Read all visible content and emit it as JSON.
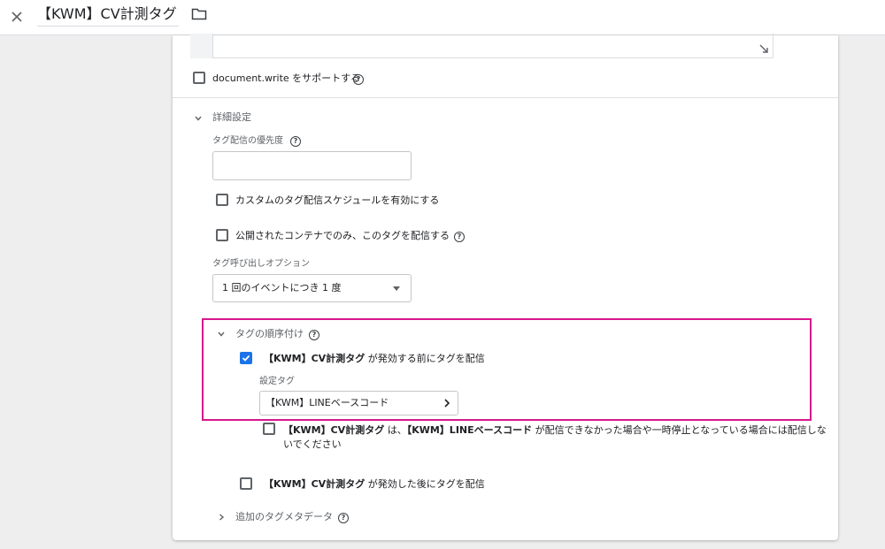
{
  "header": {
    "title": "【KWM】CV計測タグ",
    "close_icon": "close-icon",
    "folder_icon": "folder-icon"
  },
  "settings": {
    "document_write": {
      "label": "document.write をサポートする",
      "checked": false
    },
    "advanced": {
      "label": "詳細設定",
      "priority": {
        "label": "タグ配信の優先度",
        "value": ""
      },
      "custom_schedule": {
        "label": "カスタムのタグ配信スケジュールを有効にする",
        "checked": false
      },
      "published_only": {
        "label": "公開されたコンテナでのみ、このタグを配信する",
        "checked": false
      },
      "firing_option": {
        "label": "タグ呼び出しオプション",
        "value": "1 回のイベントにつき 1 度"
      }
    },
    "sequencing": {
      "label": "タグの順序付け",
      "setup": {
        "checked": true,
        "tag_name": "【KWM】CV計測タグ",
        "text": " が発効する前にタグを配信",
        "setup_tag_label": "設定タグ",
        "setup_tag_value": "【KWM】LINEベースコード"
      },
      "dont_fire": {
        "checked": false,
        "tag_name": "【KWM】CV計測タグ",
        "text_mid": " は、",
        "other_tag": "【KWM】LINEベースコード",
        "text_end_line1": " が配信できなかった場合や一時停止となっている場合には配信しな",
        "text_end_line2": "いでください"
      },
      "cleanup": {
        "checked": false,
        "tag_name": "【KWM】CV計測タグ",
        "text": " が発効した後にタグを配信"
      }
    },
    "metadata": {
      "label": "追加のタグメタデータ"
    }
  },
  "colors": {
    "accent": "#1a73e8",
    "highlight": "#d6188e"
  }
}
